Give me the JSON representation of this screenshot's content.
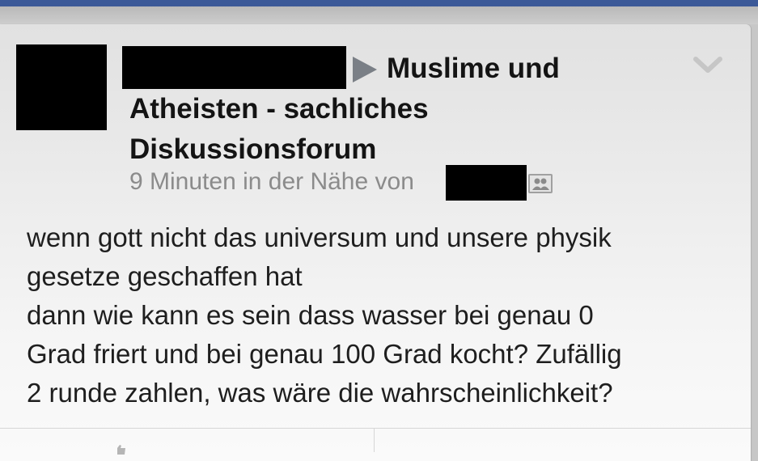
{
  "post": {
    "group_name_lines": [
      "Muslime und",
      "Atheisten - sachliches",
      "Diskussionsforum"
    ],
    "timestamp_location": "9 Minuten in der Nähe von",
    "audience_icon": "friends-icon",
    "menu_icon": "chevron-down-icon",
    "body_lines": [
      "wenn gott nicht das universum und unsere physik",
      "gesetze geschaffen hat",
      "dann wie kann es sein dass wasser bei genau 0",
      "Grad friert und bei genau 100 Grad kocht? Zufällig",
      "2 runde zahlen, was wäre die wahrscheinlichkeit?"
    ]
  },
  "colors": {
    "top_bar": "#3b5998",
    "text_primary": "#141414",
    "text_secondary": "#8b8b8b",
    "redaction": "#000000"
  }
}
